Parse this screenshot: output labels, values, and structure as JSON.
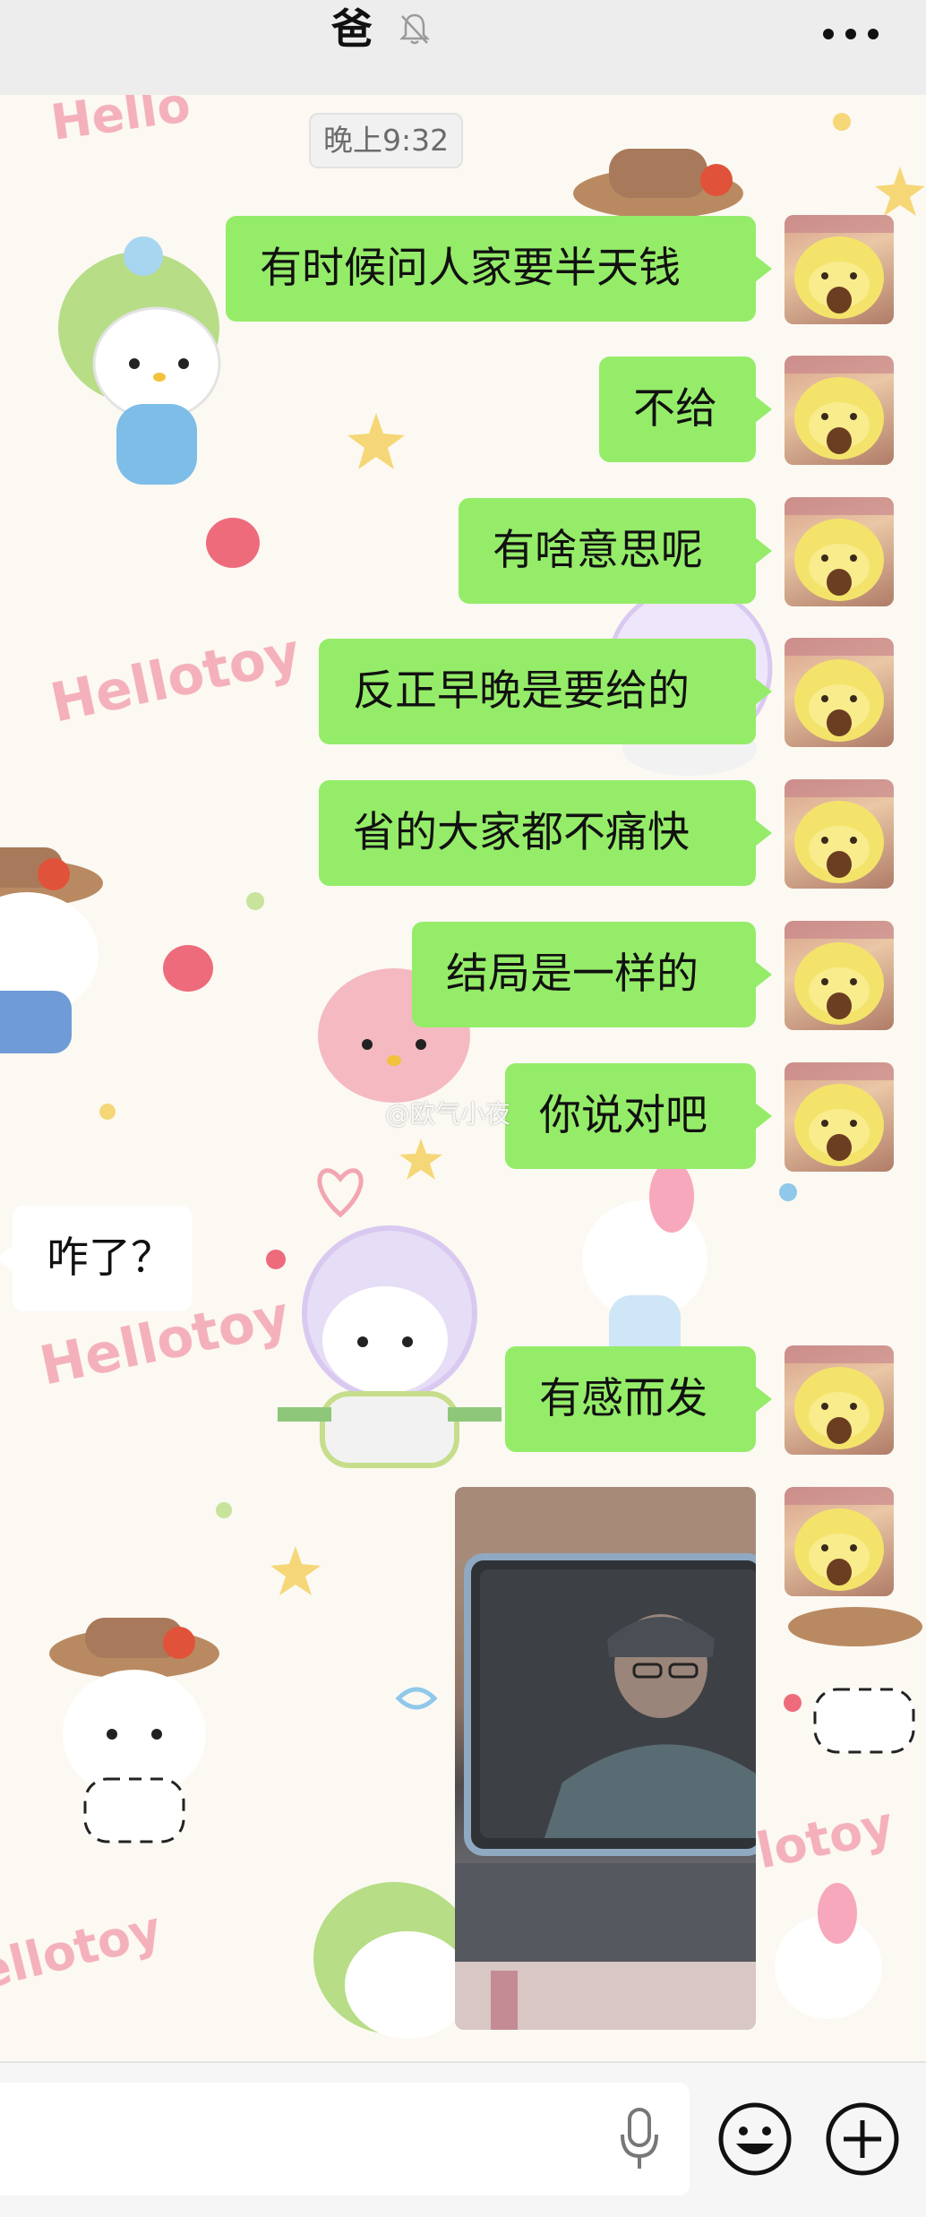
{
  "header": {
    "title": "爸",
    "mute_icon": "bell-off-icon",
    "more_icon": "more-horizontal-icon"
  },
  "timestamp": "晚上9:32",
  "messages": [
    {
      "direction": "out",
      "text": "有时候问人家要半天钱"
    },
    {
      "direction": "out",
      "text": "不给"
    },
    {
      "direction": "out",
      "text": "有啥意思呢"
    },
    {
      "direction": "out",
      "text": "反正早晚是要给的"
    },
    {
      "direction": "out",
      "text": "省的大家都不痛快"
    },
    {
      "direction": "out",
      "text": "结局是一样的"
    },
    {
      "direction": "out",
      "text": "你说对吧"
    },
    {
      "direction": "in",
      "text": "咋了？"
    },
    {
      "direction": "out",
      "text": "有感而发"
    },
    {
      "direction": "out",
      "type": "image"
    }
  ],
  "watermark": "@欧气小夜",
  "input_bar": {
    "mic_icon": "microphone-icon",
    "emoji_icon": "emoji-smile-icon",
    "plus_icon": "plus-circle-icon"
  },
  "colors": {
    "outgoing_bubble": "#95ec69",
    "incoming_bubble": "#ffffff",
    "header_bg": "#ededed",
    "chat_bg": "#fbf9f2"
  }
}
